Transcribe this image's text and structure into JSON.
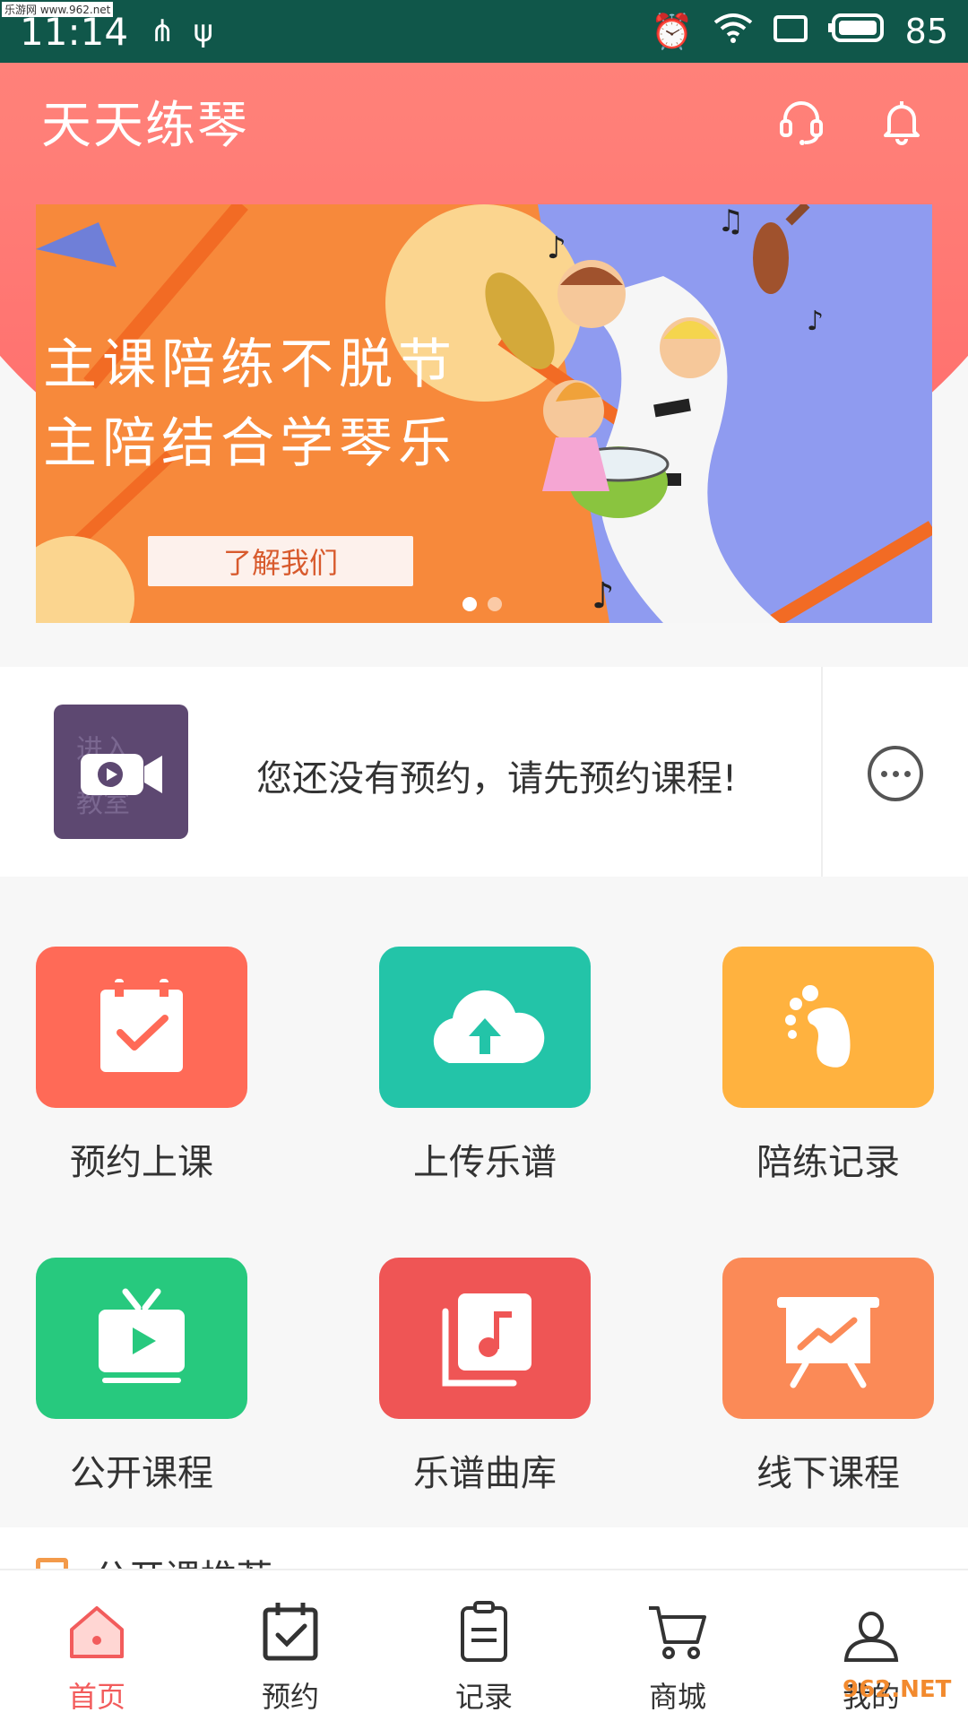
{
  "status_bar": {
    "time": "11:14",
    "battery": "85",
    "watermark": "乐游网 www.962.net"
  },
  "header": {
    "title": "天天练琴",
    "brand_color": "#ff7f78"
  },
  "banner": {
    "line1": "主课陪练不脱节",
    "line2": "主陪结合学琴乐",
    "button_label": "了解我们",
    "page_count": 2,
    "active_page": 1
  },
  "booking": {
    "message": "您还没有预约，请先预约课程!",
    "thumb_text": "进入教室"
  },
  "grid": {
    "items": [
      {
        "label": "预约上课",
        "icon": "calendar-check-icon",
        "color": "#ff6a57"
      },
      {
        "label": "上传乐谱",
        "icon": "cloud-upload-icon",
        "color": "#23c4a8"
      },
      {
        "label": "陪练记录",
        "icon": "footprint-icon",
        "color": "#ffb23f"
      },
      {
        "label": "公开课程",
        "icon": "tv-play-icon",
        "color": "#27c97e"
      },
      {
        "label": "乐谱曲库",
        "icon": "music-library-icon",
        "color": "#ef5555"
      },
      {
        "label": "线下课程",
        "icon": "presentation-chart-icon",
        "color": "#fb8a57"
      }
    ]
  },
  "recommend": {
    "title": "公开课推荐"
  },
  "bottom_nav": {
    "items": [
      {
        "label": "首页",
        "icon": "home-icon",
        "active": true
      },
      {
        "label": "预约",
        "icon": "calendar-check-icon",
        "active": false
      },
      {
        "label": "记录",
        "icon": "clipboard-icon",
        "active": false
      },
      {
        "label": "商城",
        "icon": "cart-icon",
        "active": false
      },
      {
        "label": "我的",
        "icon": "user-icon",
        "active": false
      }
    ],
    "active_color": "#f25c5c"
  },
  "footer_watermark": "962.NET"
}
